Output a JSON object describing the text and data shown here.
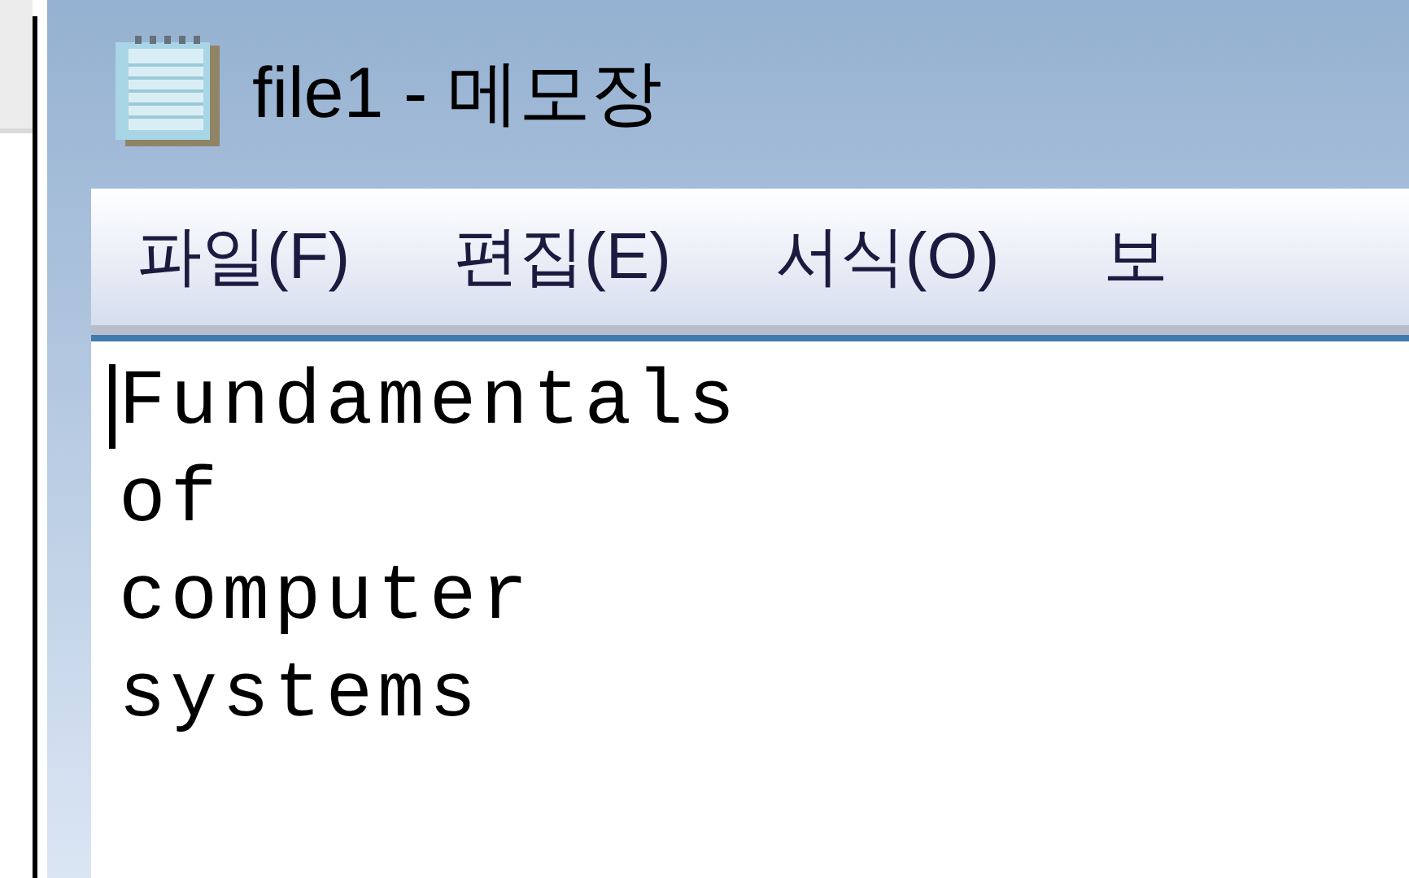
{
  "window": {
    "title": "file1 - 메모장"
  },
  "menu": [
    {
      "label": "파일(F)"
    },
    {
      "label": "편집(E)"
    },
    {
      "label": "서식(O)"
    },
    {
      "label": "보"
    }
  ],
  "editor": {
    "lines": [
      "Fundamentals",
      "of",
      "computer",
      "systems"
    ]
  }
}
